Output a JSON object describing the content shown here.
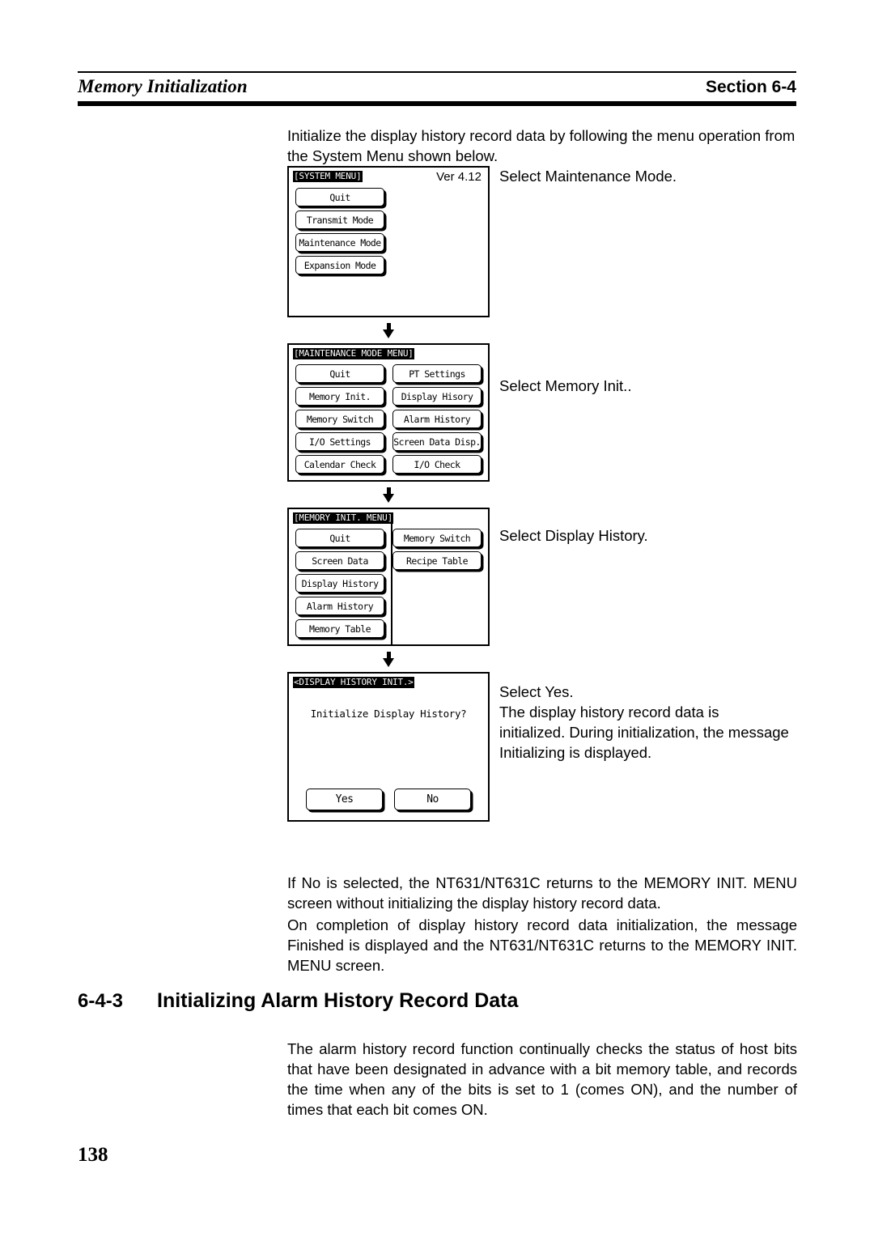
{
  "header": {
    "chapter_title": "Memory Initialization",
    "section_label": "Section 6-4"
  },
  "intro": {
    "line1": "Initialize the display history record data by following the menu operation from",
    "line2": "the System Menu shown below."
  },
  "flow": {
    "steps": [
      {
        "panel": {
          "title": "[SYSTEM MENU]",
          "version": "Ver 4.12",
          "left_buttons": [
            "Quit",
            "Transmit Mode",
            "Maintenance Mode",
            "Expansion Mode"
          ],
          "right_buttons": []
        },
        "annotation": [
          "Select Maintenance Mode."
        ]
      },
      {
        "panel": {
          "title": "[MAINTENANCE MODE MENU]",
          "version": "",
          "left_buttons": [
            "Quit",
            "Memory Init.",
            "Memory Switch",
            "I/O Settings",
            "Calendar Check"
          ],
          "right_buttons": [
            "PT Settings",
            "Display Hisory",
            "Alarm History",
            "Screen Data Disp.",
            "I/O Check"
          ]
        },
        "annotation": [
          "Select Memory Init.."
        ]
      },
      {
        "panel": {
          "title": "[MEMORY INIT. MENU]",
          "version": "",
          "left_buttons": [
            "Quit",
            "Screen Data",
            "Display History",
            "Alarm History",
            "Memory Table"
          ],
          "right_buttons": [
            "Memory Switch",
            "Recipe Table"
          ]
        },
        "annotation": [
          "Select Display History."
        ]
      }
    ],
    "dialog": {
      "title": "<DISPLAY HISTORY INIT.>",
      "prompt": "Initialize Display History?",
      "yes_label": "Yes",
      "no_label": "No",
      "annotation": [
        "Select Yes.",
        "The display history record data is",
        "initialized. During initialization, the message",
        "Initializing is displayed."
      ]
    }
  },
  "paragraphs": {
    "no_selected": "If No is selected, the NT631/NT631C returns to the MEMORY INIT. MENU screen without initializing the display history record data.",
    "completion": "On completion of display history record data initialization, the message Finished is displayed and the NT631/NT631C returns to the MEMORY INIT. MENU screen."
  },
  "section": {
    "number": "6-4-3",
    "title": "Initializing Alarm History Record Data",
    "paragraph": "The alarm history record function continually checks the status of host bits that have been designated in advance with a bit memory table, and records the time when any of the bits is set to 1 (comes ON), and the number of times that each bit comes ON."
  },
  "page_number": "138"
}
